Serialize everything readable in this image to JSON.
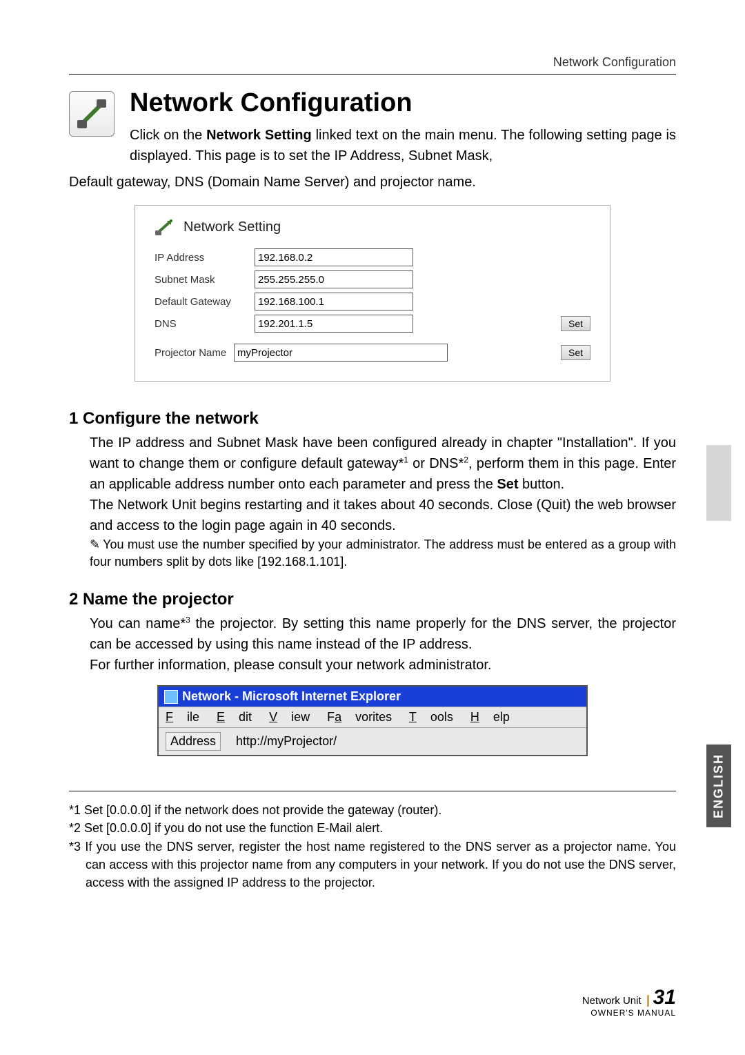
{
  "header": {
    "breadcrumb": "Network Configuration"
  },
  "title": "Network Configuration",
  "intro_line1": "Click on the ",
  "intro_bold": "Network Setting",
  "intro_line2": " linked text on the main menu. The following setting page is displayed. This page is to set the IP Address, Subnet Mask,",
  "intro_after": "Default gateway, DNS (Domain Name Server) and projector name.",
  "panel": {
    "title": "Network Setting",
    "rows": [
      {
        "label": "IP Address",
        "value": "192.168.0.2"
      },
      {
        "label": "Subnet Mask",
        "value": "255.255.255.0"
      },
      {
        "label": "Default Gateway",
        "value": "192.168.100.1"
      },
      {
        "label": "DNS",
        "value": "192.201.1.5"
      }
    ],
    "projector_label": "Projector Name",
    "projector_value": "myProjector",
    "set_label": "Set"
  },
  "section1": {
    "heading": "1 Configure the network",
    "p1a": "The IP address and Subnet Mask have been configured already in chapter \"Installation\". If you want to change them or configure default gateway*",
    "p1sup1": "1",
    "p1b": " or DNS*",
    "p1sup2": "2",
    "p1c": ", perform them in this page. Enter an applicable address number onto each parameter and press the ",
    "p1bold": "Set",
    "p1d": " button.",
    "p2": "The Network Unit begins restarting and it takes about 40 seconds. Close (Quit) the web browser and access to the login page again in 40 seconds.",
    "note": "You must use the number specified by your administrator. The address must be entered as a group with four numbers split by dots like [192.168.1.101]."
  },
  "section2": {
    "heading": "2 Name the projector",
    "p1a": "You can name*",
    "p1sup": "3",
    "p1b": " the projector. By setting this name properly for the DNS server, the projector can be accessed by using this name instead of the IP address.",
    "p2": "For further information, please consult your network administrator."
  },
  "browser": {
    "title": "Network - Microsoft Internet Explorer",
    "menu": [
      "File",
      "Edit",
      "View",
      "Favorites",
      "Tools",
      "Help"
    ],
    "addr_label": "Address",
    "url": "http://myProjector/"
  },
  "side_tab": "ENGLISH",
  "footnotes": {
    "f1": "*1 Set [0.0.0.0] if the network does not provide the gateway (router).",
    "f2": "*2 Set [0.0.0.0] if you do not use the function E-Mail alert.",
    "f3": "*3 If you use the DNS server, register the host name registered to the DNS server as a projector name. You can access with this projector name from any computers in your network. If you do not use the DNS server, access with the assigned IP address to the projector."
  },
  "footer": {
    "unit": "Network Unit",
    "page": "31",
    "manual": "OWNER'S MANUAL"
  }
}
